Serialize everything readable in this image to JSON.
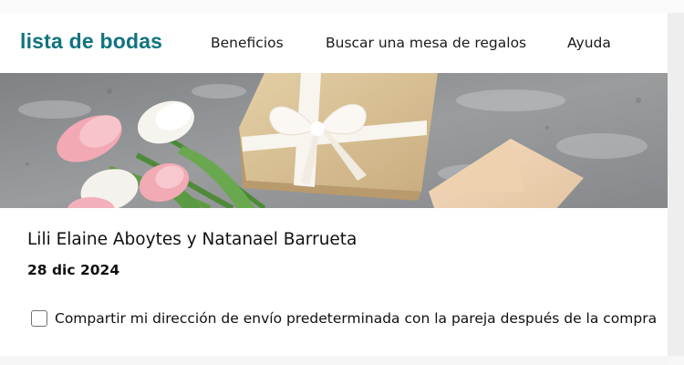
{
  "header": {
    "brand": "lista de bodas",
    "nav": [
      {
        "label": "Beneficios"
      },
      {
        "label": "Buscar una mesa de regalos"
      },
      {
        "label": "Ayuda"
      }
    ]
  },
  "banner": {
    "image_subject": "gift box with white ribbon, tulips and envelope on grey concrete"
  },
  "registry": {
    "couple_names": "Lili Elaine Aboytes y Natanael Barrueta",
    "event_date": "28 dic 2024"
  },
  "share_address": {
    "checked": false,
    "label": "Compartir mi dirección de envío predeterminada con la pareja después de la compra"
  },
  "colors": {
    "brand": "#107380",
    "text": "#0f1111",
    "checkbox_border": "#6f7373"
  }
}
